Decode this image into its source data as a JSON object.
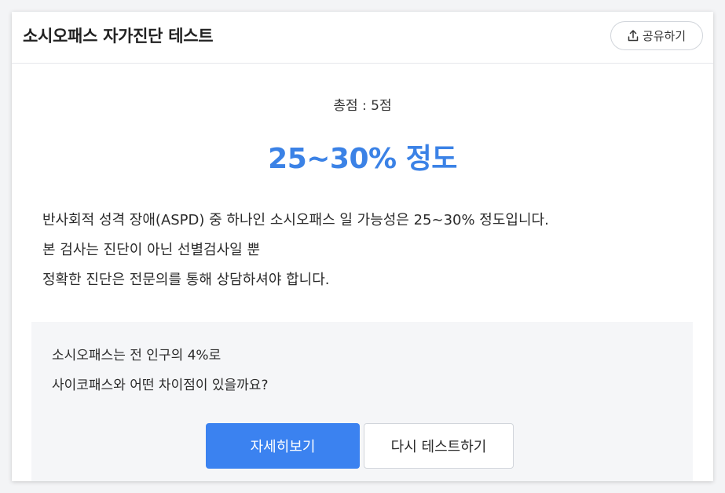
{
  "header": {
    "title": "소시오패스 자가진단 테스트",
    "share_label": "공유하기",
    "share_icon": "upload-icon"
  },
  "result": {
    "score_text": "총점 : 5점",
    "headline": "25~30% 정도",
    "accent_color": "#3b82e6",
    "description_lines": [
      "반사회적 성격 장애(ASPD) 중 하나인 소시오패스 일 가능성은 25~30% 정도입니다.",
      "본 검사는 진단이 아닌 선별검사일 뿐",
      "정확한 진단은 전문의를 통해 상담하셔야 합니다."
    ]
  },
  "info": {
    "lines": [
      "소시오패스는 전 인구의 4%로",
      "사이코패스와 어떤 차이점이 있을까요?"
    ],
    "primary_button": "자세히보기",
    "secondary_button": "다시 테스트하기"
  }
}
